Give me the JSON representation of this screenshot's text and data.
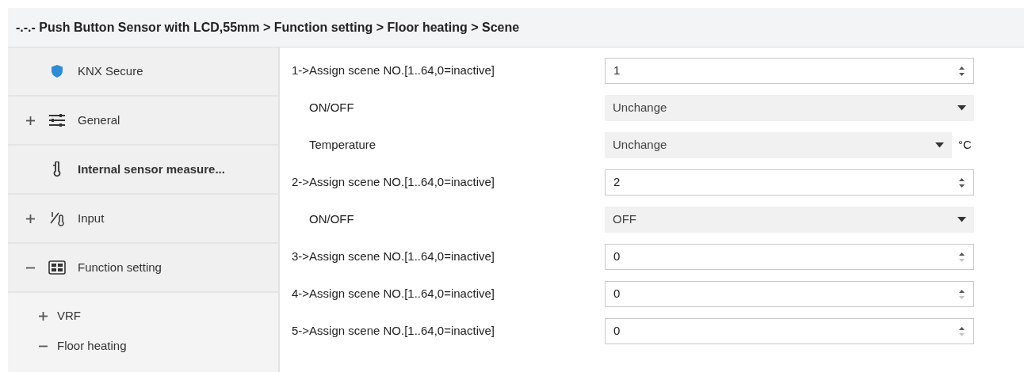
{
  "breadcrumb": "-.-.- Push Button Sensor with LCD,55mm > Function setting > Floor heating > Scene",
  "sidebar": {
    "items": [
      {
        "label": "KNX Secure",
        "kind": "shield",
        "bold": false
      },
      {
        "label": "General",
        "kind": "sliders",
        "bold": false,
        "expanded": false
      },
      {
        "label": "Internal sensor measure...",
        "kind": "thermometer",
        "bold": true
      },
      {
        "label": "Input",
        "kind": "input",
        "bold": false,
        "expanded": false
      },
      {
        "label": "Function setting",
        "kind": "grid",
        "bold": false,
        "expanded": true,
        "children": [
          {
            "label": "VRF",
            "expanded": false
          },
          {
            "label": "Floor heating",
            "expanded": true
          }
        ]
      }
    ]
  },
  "parameters": [
    {
      "label": "1->Assign scene NO.[1..64,0=inactive]",
      "indent": false,
      "kind": "spin",
      "value": "1",
      "down_disabled": false
    },
    {
      "label": "ON/OFF",
      "indent": true,
      "kind": "dropdown",
      "value": "Unchange"
    },
    {
      "label": "Temperature",
      "indent": true,
      "kind": "dropdown",
      "value": "Unchange",
      "unit": "°C"
    },
    {
      "label": "2->Assign scene NO.[1..64,0=inactive]",
      "indent": false,
      "kind": "spin",
      "value": "2",
      "down_disabled": false
    },
    {
      "label": "ON/OFF",
      "indent": true,
      "kind": "dropdown",
      "value": "OFF"
    },
    {
      "label": "3->Assign scene NO.[1..64,0=inactive]",
      "indent": false,
      "kind": "spin",
      "value": "0",
      "down_disabled": true
    },
    {
      "label": "4->Assign scene NO.[1..64,0=inactive]",
      "indent": false,
      "kind": "spin",
      "value": "0",
      "down_disabled": true
    },
    {
      "label": "5->Assign scene NO.[1..64,0=inactive]",
      "indent": false,
      "kind": "spin",
      "value": "0",
      "down_disabled": true
    }
  ]
}
